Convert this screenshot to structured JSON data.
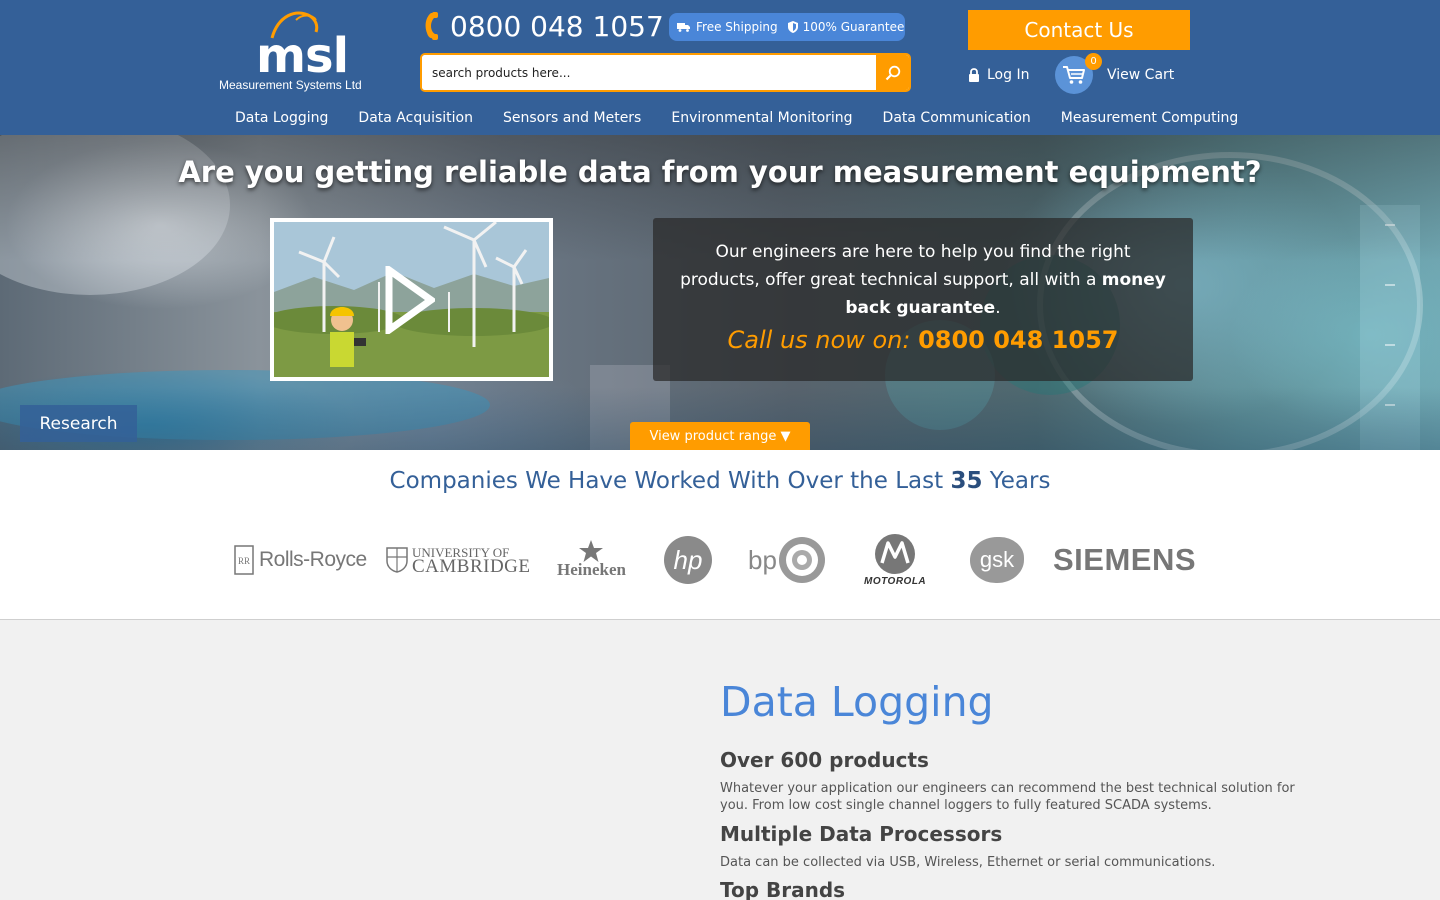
{
  "header": {
    "logo_mark": "msl",
    "logo_sub": "Measurement Systems Ltd",
    "phone": "0800 048 1057",
    "badges": {
      "shipping": "Free Shipping",
      "guarantee": "100% Guarantee"
    },
    "search_placeholder": "search products here...",
    "contact_label": "Contact Us",
    "login_label": "Log In",
    "cart_label": "View Cart",
    "cart_count": "0",
    "accent_color": "#ff9c00",
    "brand_color": "#346098"
  },
  "nav": {
    "items": [
      {
        "label": "Data Logging"
      },
      {
        "label": "Data Acquisition"
      },
      {
        "label": "Sensors and Meters"
      },
      {
        "label": "Environmental Monitoring"
      },
      {
        "label": "Data Communication"
      },
      {
        "label": "Measurement Computing"
      }
    ]
  },
  "hero": {
    "title": "Are you getting reliable data from your measurement equipment?",
    "info_text_1": "Our engineers are here to help you find the right products, offer great technical support, all with a ",
    "info_text_bold": "money back guarantee",
    "info_text_2": ".",
    "call_label": "Call us now on: ",
    "call_number": "0800 048 1057",
    "slide_tag": "Research",
    "range_button": "View product range ▼"
  },
  "companies": {
    "title_prefix": "Companies We Have Worked With Over the Last ",
    "title_years": "35",
    "title_suffix": " Years",
    "logos": [
      {
        "name": "Rolls-Royce"
      },
      {
        "name": "UNIVERSITY OF",
        "name2": "CAMBRIDGE"
      },
      {
        "name": "Heineken"
      },
      {
        "name": "hp"
      },
      {
        "name": "bp"
      },
      {
        "name": "MOTOROLA"
      },
      {
        "name": "gsk"
      },
      {
        "name": "SIEMENS"
      }
    ]
  },
  "data_logging": {
    "title": "Data Logging",
    "blocks": [
      {
        "heading": "Over 600 products",
        "text": "Whatever your application our engineers can recommend the best technical solution for you. From low cost single channel loggers to fully featured SCADA systems."
      },
      {
        "heading": "Multiple Data Processors",
        "text": "Data can be collected via USB, Wireless, Ethernet or serial communications."
      },
      {
        "heading": "Top Brands",
        "text": ""
      }
    ]
  }
}
